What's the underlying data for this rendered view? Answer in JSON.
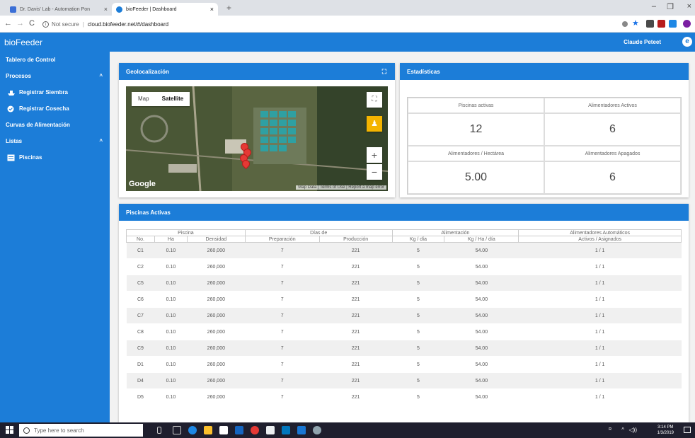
{
  "browser": {
    "tabs": [
      {
        "title": "Dr. Davis' Lab - Automation Pon",
        "close": "×"
      },
      {
        "title": "bioFeeder | Dashboard",
        "close": "×"
      }
    ],
    "new_tab": "+",
    "window_controls": {
      "minimize": "–",
      "restore": "❐",
      "close": "×"
    },
    "nav": {
      "back": "←",
      "forward": "→",
      "reload": "C"
    },
    "address": {
      "security": "Not secure",
      "url": "cloud.biofeeder.net/#/dashboard"
    }
  },
  "app": {
    "brand": "bioFeeder",
    "user": "Claude Peteet",
    "accent": "#1c7dd8"
  },
  "sidebar": {
    "items": [
      {
        "label": "Tablero de Control"
      },
      {
        "label": "Procesos",
        "chevron": "^"
      },
      {
        "label": "Registrar Siembra",
        "icon": "ship-icon"
      },
      {
        "label": "Registrar Cosecha",
        "icon": "check-circle-icon"
      },
      {
        "label": "Curvas de Alimentación"
      },
      {
        "label": "Listas",
        "chevron": "^"
      },
      {
        "label": "Piscinas",
        "icon": "list-box-icon"
      }
    ]
  },
  "geo": {
    "title": "Geolocalización",
    "map_type": [
      "Map",
      "Satellite"
    ],
    "selected_map_type": "Satellite",
    "google": "Google",
    "attribution": "Map Data | Terms of Use | Report a map error",
    "zoom_in": "+",
    "zoom_out": "−"
  },
  "stats": {
    "title": "Estadísticas",
    "items": [
      {
        "label": "Piscinas activas",
        "value": "12"
      },
      {
        "label": "Alimentadores Activos",
        "value": "6"
      },
      {
        "label": "Alimentadores / Hectárea",
        "value": "5.00"
      },
      {
        "label": "Alimentadores Apagados",
        "value": "6"
      }
    ]
  },
  "pools": {
    "title": "Piscinas Activas",
    "groups": [
      "Piscina",
      "Días de",
      "Alimentación",
      "Alimentadores Automáticos"
    ],
    "columns": [
      "No.",
      "Ha",
      "Densidad",
      "Preparación",
      "Producción",
      "Kg / día",
      "Kg / Ha / día",
      "Activos / Asignados"
    ],
    "rows": [
      [
        "C1",
        "0.10",
        "260,000",
        "7",
        "221",
        "5",
        "54.00",
        "1 / 1"
      ],
      [
        "C2",
        "0.10",
        "260,000",
        "7",
        "221",
        "5",
        "54.00",
        "1 / 1"
      ],
      [
        "C5",
        "0.10",
        "260,000",
        "7",
        "221",
        "5",
        "54.00",
        "1 / 1"
      ],
      [
        "C6",
        "0.10",
        "260,000",
        "7",
        "221",
        "5",
        "54.00",
        "1 / 1"
      ],
      [
        "C7",
        "0.10",
        "260,000",
        "7",
        "221",
        "5",
        "54.00",
        "1 / 1"
      ],
      [
        "C8",
        "0.10",
        "260,000",
        "7",
        "221",
        "5",
        "54.00",
        "1 / 1"
      ],
      [
        "C9",
        "0.10",
        "260,000",
        "7",
        "221",
        "5",
        "54.00",
        "1 / 1"
      ],
      [
        "D1",
        "0.10",
        "260,000",
        "7",
        "221",
        "5",
        "54.00",
        "1 / 1"
      ],
      [
        "D4",
        "0.10",
        "260,000",
        "7",
        "221",
        "5",
        "54.00",
        "1 / 1"
      ],
      [
        "D5",
        "0.10",
        "260,000",
        "7",
        "221",
        "5",
        "54.00",
        "1 / 1"
      ]
    ]
  },
  "taskbar": {
    "search_placeholder": "Type here to search",
    "time": "3:14 PM",
    "date": "1/3/2019"
  }
}
